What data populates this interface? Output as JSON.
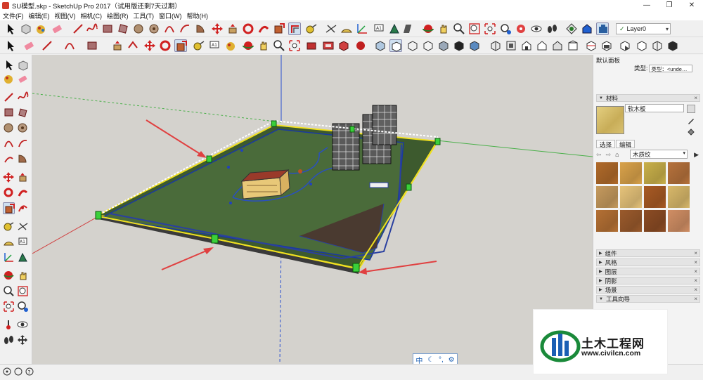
{
  "window": {
    "title": "SU模型.skp - SketchUp Pro 2017（试用版还剩7天过期）",
    "min_label": "—",
    "max_label": "❐",
    "close_label": "✕"
  },
  "menu": [
    "文件(F)",
    "编辑(E)",
    "视图(V)",
    "相机(C)",
    "绘图(R)",
    "工具(T)",
    "窗口(W)",
    "帮助(H)"
  ],
  "layer": {
    "value": "Layer0"
  },
  "tray": {
    "title": "默认面板",
    "type_label": "类型:",
    "type_value": "类型：<unde…",
    "materials": {
      "header": "材料",
      "name": "软木板",
      "tab_select": "选择",
      "tab_edit": "编辑",
      "library": "木质纹"
    },
    "sections": [
      "组件",
      "风格",
      "图层",
      "阴影",
      "场景",
      "工具向导"
    ]
  },
  "viewport": {
    "input_icons": [
      "中",
      "☾",
      "°,",
      "⚙"
    ]
  },
  "watermark": {
    "title": "土木工程网",
    "url": "www.civilcn.com"
  },
  "colors": {
    "viewport_bg": "#d4d2cd",
    "ground_green": "#4a6b3a",
    "selection_yellow": "#f0e020",
    "arrow_red": "#e04040"
  },
  "swatches": [
    "#b06a2a",
    "#d9a24a",
    "#c9b04a",
    "#b6723c",
    "#c59a5e",
    "#e6c37a",
    "#a85a24",
    "#d8b86a",
    "#b47034",
    "#9a5a2c",
    "#8c4c24",
    "#d08e64"
  ]
}
